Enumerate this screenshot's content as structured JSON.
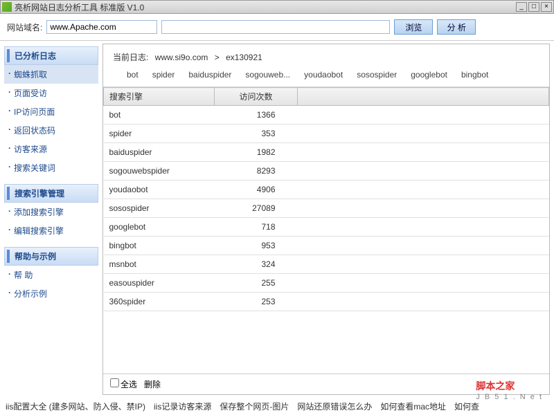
{
  "window": {
    "title": "亮析网站日志分析工具 标准版 V1.0"
  },
  "toolbar": {
    "domain_label": "网站域名:",
    "domain_value": "www.Apache.com",
    "browse_label": "浏览",
    "analyze_label": "分 析"
  },
  "sidebar": {
    "sections": [
      {
        "title": "已分析日志",
        "items": [
          "蜘蛛抓取",
          "页面受访",
          "IP访问页面",
          "返回状态码",
          "访客来源",
          "搜索关键词"
        ],
        "active": 0
      },
      {
        "title": "搜索引擎管理",
        "items": [
          "添加搜索引擎",
          "编辑搜索引擎"
        ]
      },
      {
        "title": "帮助与示例",
        "items": [
          "帮 助",
          "分析示例"
        ]
      }
    ]
  },
  "header": {
    "label": "当前日志:",
    "domain": "www.si9o.com",
    "sep": ">",
    "file": "ex130921",
    "bots": [
      "bot",
      "spider",
      "baiduspider",
      "sogouweb...",
      "youdaobot",
      "sosospider",
      "googlebot",
      "bingbot"
    ]
  },
  "table": {
    "columns": [
      "搜索引擎",
      "访问次数",
      ""
    ],
    "rows": [
      {
        "name": "bot",
        "count": 1366
      },
      {
        "name": "spider",
        "count": 353
      },
      {
        "name": "baiduspider",
        "count": 1982
      },
      {
        "name": "sogouwebspider",
        "count": 8293
      },
      {
        "name": "youdaobot",
        "count": 4906
      },
      {
        "name": "sosospider",
        "count": 27089
      },
      {
        "name": "googlebot",
        "count": 718
      },
      {
        "name": "bingbot",
        "count": 953
      },
      {
        "name": "msnbot",
        "count": 324
      },
      {
        "name": "easouspider",
        "count": 255
      },
      {
        "name": "360spider",
        "count": 253
      }
    ]
  },
  "footer": {
    "selectall": "全选",
    "delete": "删除"
  },
  "bottomlinks": [
    "iis配置大全 (建多网站、防入侵、禁IP)",
    "iis记录访客来源",
    "保存整个网页-图片",
    "网站还原错误怎么办",
    "如何查看mac地址",
    "如何查"
  ],
  "watermark": {
    "cn": "脚本之家",
    "en": "J B 5 1 . N e t"
  }
}
